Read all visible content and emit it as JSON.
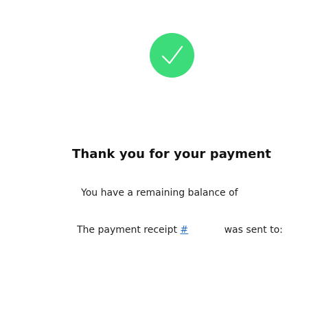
{
  "status": {
    "icon": "checkmark-icon",
    "color": "#3ddc7a"
  },
  "title": "Thank you for your payment",
  "balance": {
    "text": "You have a remaining balance of",
    "amount": ""
  },
  "receipt": {
    "prefix": "The payment receipt",
    "link_text": "#",
    "number": "",
    "suffix": "was sent to:",
    "recipient": ""
  }
}
